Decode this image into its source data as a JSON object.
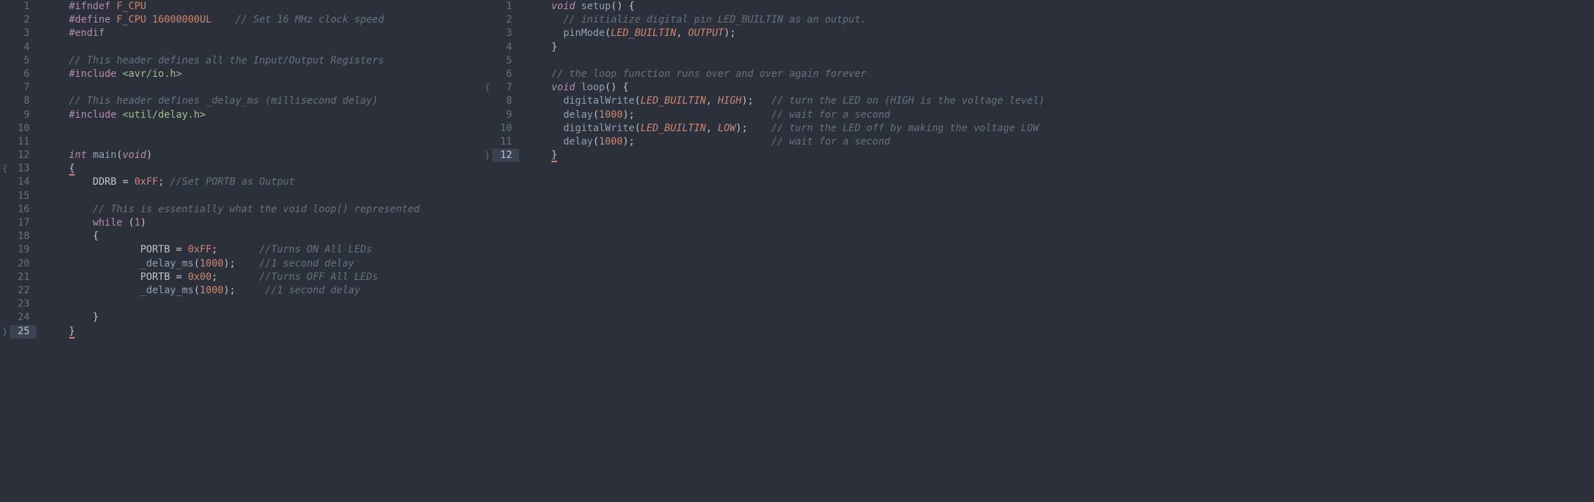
{
  "left_pane": {
    "lines": [
      {
        "n": 1,
        "fold": "",
        "tokens": [
          [
            "",
            "    "
          ],
          [
            "tok-preproc",
            "#ifndef"
          ],
          [
            "",
            " "
          ],
          [
            "tok-macro",
            "F_CPU"
          ]
        ]
      },
      {
        "n": 2,
        "fold": "",
        "tokens": [
          [
            "",
            "    "
          ],
          [
            "tok-preproc",
            "#define"
          ],
          [
            "",
            " "
          ],
          [
            "tok-macro",
            "F_CPU"
          ],
          [
            "",
            " "
          ],
          [
            "tok-macro",
            "16000000UL"
          ],
          [
            "",
            "    "
          ],
          [
            "tok-comment",
            "// Set 16 MHz clock speed"
          ]
        ]
      },
      {
        "n": 3,
        "fold": "",
        "tokens": [
          [
            "",
            "    "
          ],
          [
            "tok-preproc",
            "#endif"
          ]
        ]
      },
      {
        "n": 4,
        "fold": "",
        "tokens": []
      },
      {
        "n": 5,
        "fold": "",
        "tokens": [
          [
            "",
            "    "
          ],
          [
            "tok-comment",
            "// This header defines all the Input/Output Registers"
          ]
        ]
      },
      {
        "n": 6,
        "fold": "",
        "tokens": [
          [
            "",
            "    "
          ],
          [
            "tok-preproc",
            "#include"
          ],
          [
            "",
            " "
          ],
          [
            "tok-string",
            "<avr/io.h>"
          ]
        ]
      },
      {
        "n": 7,
        "fold": "",
        "tokens": []
      },
      {
        "n": 8,
        "fold": "",
        "tokens": [
          [
            "",
            "    "
          ],
          [
            "tok-comment",
            "// This header defines _delay_ms (millisecond delay)"
          ]
        ]
      },
      {
        "n": 9,
        "fold": "",
        "tokens": [
          [
            "",
            "    "
          ],
          [
            "tok-preproc",
            "#include"
          ],
          [
            "",
            " "
          ],
          [
            "tok-string",
            "<util/delay.h>"
          ]
        ]
      },
      {
        "n": 10,
        "fold": "",
        "tokens": []
      },
      {
        "n": 11,
        "fold": "",
        "tokens": []
      },
      {
        "n": 12,
        "fold": "",
        "tokens": [
          [
            "",
            "    "
          ],
          [
            "tok-type",
            "int"
          ],
          [
            "",
            " "
          ],
          [
            "tok-func",
            "main"
          ],
          [
            "tok-paren",
            "("
          ],
          [
            "tok-type",
            "void"
          ],
          [
            "tok-paren",
            ")"
          ]
        ]
      },
      {
        "n": 13,
        "fold": "{",
        "tokens": [
          [
            "",
            "    "
          ],
          [
            "tok-punct underline-cursor",
            "{"
          ]
        ]
      },
      {
        "n": 14,
        "fold": "",
        "tokens": [
          [
            "",
            "        "
          ],
          [
            "tok-var",
            "DDRB"
          ],
          [
            "",
            " "
          ],
          [
            "tok-op",
            "="
          ],
          [
            "",
            " "
          ],
          [
            "tok-num",
            "0xFF"
          ],
          [
            "tok-punct",
            ";"
          ],
          [
            "",
            " "
          ],
          [
            "tok-comment",
            "//Set PORTB as Output"
          ]
        ]
      },
      {
        "n": 15,
        "fold": "",
        "tokens": []
      },
      {
        "n": 16,
        "fold": "",
        "tokens": [
          [
            "",
            "        "
          ],
          [
            "tok-comment",
            "// This is essentially what the void loop() represented"
          ]
        ]
      },
      {
        "n": 17,
        "fold": "",
        "tokens": [
          [
            "",
            "        "
          ],
          [
            "tok-keyword",
            "while"
          ],
          [
            "",
            " "
          ],
          [
            "tok-paren",
            "("
          ],
          [
            "tok-num",
            "1"
          ],
          [
            "tok-paren",
            ")"
          ]
        ]
      },
      {
        "n": 18,
        "fold": "",
        "tokens": [
          [
            "",
            "        "
          ],
          [
            "tok-punct",
            "{"
          ]
        ]
      },
      {
        "n": 19,
        "fold": "",
        "tokens": [
          [
            "",
            "                "
          ],
          [
            "tok-var",
            "PORTB"
          ],
          [
            "",
            " "
          ],
          [
            "tok-op",
            "="
          ],
          [
            "",
            " "
          ],
          [
            "tok-num",
            "0xFF"
          ],
          [
            "tok-punct",
            ";"
          ],
          [
            "",
            "       "
          ],
          [
            "tok-comment",
            "//Turns ON All LEDs"
          ]
        ]
      },
      {
        "n": 20,
        "fold": "",
        "tokens": [
          [
            "",
            "                "
          ],
          [
            "tok-func",
            "_delay_ms"
          ],
          [
            "tok-paren",
            "("
          ],
          [
            "tok-num",
            "1000"
          ],
          [
            "tok-paren",
            ")"
          ],
          [
            "tok-punct",
            ";"
          ],
          [
            "",
            "    "
          ],
          [
            "tok-comment",
            "//1 second delay"
          ]
        ]
      },
      {
        "n": 21,
        "fold": "",
        "tokens": [
          [
            "",
            "                "
          ],
          [
            "tok-var",
            "PORTB"
          ],
          [
            "",
            " "
          ],
          [
            "tok-op",
            "="
          ],
          [
            "",
            " "
          ],
          [
            "tok-num",
            "0x00"
          ],
          [
            "tok-punct",
            ";"
          ],
          [
            "",
            "       "
          ],
          [
            "tok-comment",
            "//Turns OFF All LEDs"
          ]
        ]
      },
      {
        "n": 22,
        "fold": "",
        "tokens": [
          [
            "",
            "                "
          ],
          [
            "tok-func",
            "_delay_ms"
          ],
          [
            "tok-paren",
            "("
          ],
          [
            "tok-num",
            "1000"
          ],
          [
            "tok-paren",
            ")"
          ],
          [
            "tok-punct",
            ";"
          ],
          [
            "",
            "     "
          ],
          [
            "tok-comment",
            "//1 second delay"
          ]
        ]
      },
      {
        "n": 23,
        "fold": "",
        "tokens": []
      },
      {
        "n": 24,
        "fold": "",
        "tokens": [
          [
            "",
            "        "
          ],
          [
            "tok-punct",
            "}"
          ]
        ]
      },
      {
        "n": 25,
        "fold": "}",
        "hl": true,
        "tokens": [
          [
            "",
            "    "
          ],
          [
            "tok-punct underline-cursor",
            "}"
          ]
        ]
      }
    ]
  },
  "right_pane": {
    "lines": [
      {
        "n": 1,
        "fold": "",
        "tokens": [
          [
            "",
            "    "
          ],
          [
            "tok-type",
            "void"
          ],
          [
            "",
            " "
          ],
          [
            "tok-func",
            "setup"
          ],
          [
            "tok-paren",
            "()"
          ],
          [
            "",
            " "
          ],
          [
            "tok-punct",
            "{"
          ]
        ]
      },
      {
        "n": 2,
        "fold": "",
        "tokens": [
          [
            "",
            "      "
          ],
          [
            "tok-comment",
            "// initialize digital pin LED_BUILTIN as an output."
          ]
        ]
      },
      {
        "n": 3,
        "fold": "",
        "tokens": [
          [
            "",
            "      "
          ],
          [
            "tok-func",
            "pinMode"
          ],
          [
            "tok-paren",
            "("
          ],
          [
            "tok-const",
            "LED_BUILTIN"
          ],
          [
            "tok-punct",
            ", "
          ],
          [
            "tok-const",
            "OUTPUT"
          ],
          [
            "tok-paren",
            ")"
          ],
          [
            "tok-punct",
            ";"
          ]
        ]
      },
      {
        "n": 4,
        "fold": "",
        "tokens": [
          [
            "",
            "    "
          ],
          [
            "tok-punct",
            "}"
          ]
        ]
      },
      {
        "n": 5,
        "fold": "",
        "tokens": []
      },
      {
        "n": 6,
        "fold": "",
        "tokens": [
          [
            "",
            "    "
          ],
          [
            "tok-comment",
            "// the loop function runs over and over again forever"
          ]
        ]
      },
      {
        "n": 7,
        "fold": "{",
        "tokens": [
          [
            "",
            "    "
          ],
          [
            "tok-type",
            "void"
          ],
          [
            "",
            " "
          ],
          [
            "tok-func",
            "loop"
          ],
          [
            "tok-paren",
            "()"
          ],
          [
            "",
            " "
          ],
          [
            "tok-punct",
            "{"
          ]
        ]
      },
      {
        "n": 8,
        "fold": "",
        "tokens": [
          [
            "",
            "      "
          ],
          [
            "tok-func",
            "digitalWrite"
          ],
          [
            "tok-paren",
            "("
          ],
          [
            "tok-const",
            "LED_BUILTIN"
          ],
          [
            "tok-punct",
            ", "
          ],
          [
            "tok-const",
            "HIGH"
          ],
          [
            "tok-paren",
            ")"
          ],
          [
            "tok-punct",
            ";"
          ],
          [
            "",
            "   "
          ],
          [
            "tok-comment",
            "// turn the LED on (HIGH is the voltage level)"
          ]
        ]
      },
      {
        "n": 9,
        "fold": "",
        "tokens": [
          [
            "",
            "      "
          ],
          [
            "tok-func",
            "delay"
          ],
          [
            "tok-paren",
            "("
          ],
          [
            "tok-num",
            "1000"
          ],
          [
            "tok-paren",
            ")"
          ],
          [
            "tok-punct",
            ";"
          ],
          [
            "",
            "                       "
          ],
          [
            "tok-comment",
            "// wait for a second"
          ]
        ]
      },
      {
        "n": 10,
        "fold": "",
        "tokens": [
          [
            "",
            "      "
          ],
          [
            "tok-func",
            "digitalWrite"
          ],
          [
            "tok-paren",
            "("
          ],
          [
            "tok-const",
            "LED_BUILTIN"
          ],
          [
            "tok-punct",
            ", "
          ],
          [
            "tok-const",
            "LOW"
          ],
          [
            "tok-paren",
            ")"
          ],
          [
            "tok-punct",
            ";"
          ],
          [
            "",
            "    "
          ],
          [
            "tok-comment",
            "// turn the LED off by making the voltage LOW"
          ]
        ]
      },
      {
        "n": 11,
        "fold": "",
        "tokens": [
          [
            "",
            "      "
          ],
          [
            "tok-func",
            "delay"
          ],
          [
            "tok-paren",
            "("
          ],
          [
            "tok-num",
            "1000"
          ],
          [
            "tok-paren",
            ")"
          ],
          [
            "tok-punct",
            ";"
          ],
          [
            "",
            "                       "
          ],
          [
            "tok-comment",
            "// wait for a second"
          ]
        ]
      },
      {
        "n": 12,
        "fold": "}",
        "hl": true,
        "tokens": [
          [
            "",
            "    "
          ],
          [
            "tok-punct underline-cursor",
            "}"
          ]
        ]
      }
    ]
  }
}
